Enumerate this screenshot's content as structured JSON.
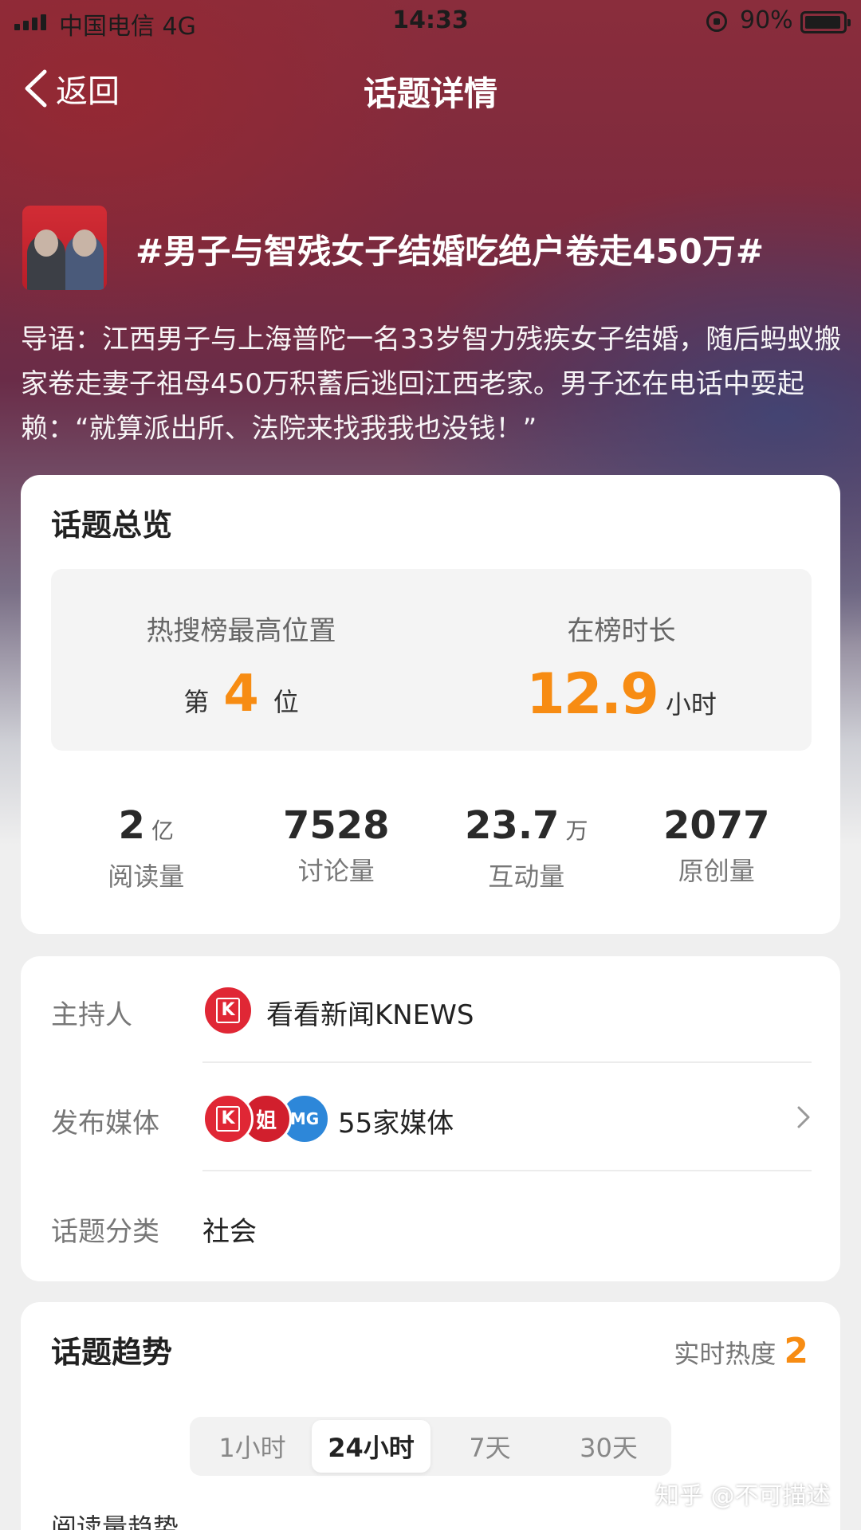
{
  "status_bar": {
    "carrier": "中国电信   4G",
    "time": "14:33",
    "battery": "90%"
  },
  "nav": {
    "back_label": "返回",
    "title": "话题详情"
  },
  "topic": {
    "title": "#男子与智残女子结婚吃绝户卷走450万#",
    "intro": "导语：江西男子与上海普陀一名33岁智力残疾女子结婚，随后蚂蚁搬家卷走妻子祖母450万积蓄后逃回江西老家。男子还在电话中耍起赖：“就算派出所、法院来找我我也没钱！”"
  },
  "overview": {
    "heading": "话题总览",
    "rank": {
      "label": "热搜榜最高位置",
      "prefix": "第",
      "value": "4",
      "suffix": "位"
    },
    "duration": {
      "label": "在榜时长",
      "value": "12.9",
      "suffix": "小时"
    },
    "stats": [
      {
        "value": "2",
        "unit": "亿",
        "label": "阅读量"
      },
      {
        "value": "7528",
        "unit": "",
        "label": "讨论量"
      },
      {
        "value": "23.7",
        "unit": "万",
        "label": "互动量"
      },
      {
        "value": "2077",
        "unit": "",
        "label": "原创量"
      }
    ]
  },
  "info": {
    "host_label": "主持人",
    "host_value": "看看新闻KNEWS",
    "media_label": "发布媒体",
    "media_value": "55家媒体",
    "category_label": "话题分类",
    "category_value": "社会",
    "media_logos": [
      "K",
      "姐",
      "MG"
    ]
  },
  "trend": {
    "heading": "话题趋势",
    "realtime_label": "实时热度",
    "realtime_value": "2",
    "tabs": [
      {
        "label": "1小时",
        "active": false
      },
      {
        "label": "24小时",
        "active": true
      },
      {
        "label": "7天",
        "active": false
      },
      {
        "label": "30天",
        "active": false
      }
    ],
    "sub_heading": "阅读量趋势"
  },
  "watermark": "知乎 @不可描述",
  "colors": {
    "accent": "#f78c13",
    "hero_red": "#8a2d3c",
    "hero_blue": "#3c4678"
  }
}
